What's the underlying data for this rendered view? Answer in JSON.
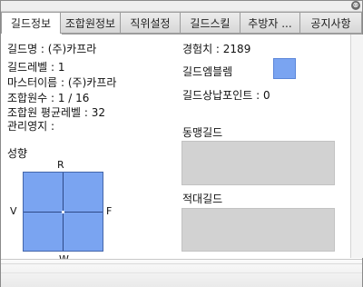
{
  "window": {
    "close_glyph": "⊗"
  },
  "tabs": [
    {
      "label": "길드정보",
      "active": true
    },
    {
      "label": "조합원정보",
      "active": false
    },
    {
      "label": "직위설정",
      "active": false
    },
    {
      "label": "길드스킬",
      "active": false
    },
    {
      "label": "추방자 ...",
      "active": false
    },
    {
      "label": "공지사항",
      "active": false
    }
  ],
  "info": {
    "guild_name": "길드명 : (주)카프라",
    "guild_level": "길드레벨 : 1",
    "master_name": "마스터이름 : (주)카프라",
    "member_count": "조합원수 : 1 / 16",
    "avg_level": "조합원 평균레벨 : 32",
    "territory": "관리영지 :",
    "experience": "경험치 : 2189",
    "emblem_label": "길드엠블렘",
    "tribute_points": "길드상납포인트 : 0"
  },
  "sections": {
    "alliance": "동맹길드",
    "enemy": "적대길드",
    "tendency": "성향"
  },
  "compass": {
    "top": "R",
    "bottom": "W",
    "left": "V",
    "right": "F"
  },
  "colors": {
    "emblem": "#7aa4f1",
    "compass": "#7aa4f1",
    "panel": "#d2d2d2"
  }
}
